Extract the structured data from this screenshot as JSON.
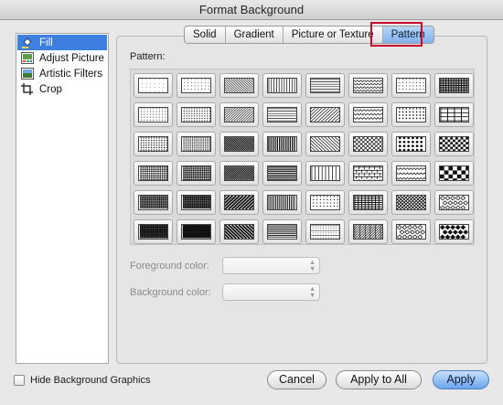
{
  "window": {
    "title": "Format Background"
  },
  "sidebar": {
    "items": [
      {
        "label": "Fill",
        "icon": "paint-bucket-icon",
        "selected": true
      },
      {
        "label": "Adjust Picture",
        "icon": "adjust-picture-icon",
        "selected": false
      },
      {
        "label": "Artistic Filters",
        "icon": "artistic-filters-icon",
        "selected": false
      },
      {
        "label": "Crop",
        "icon": "crop-icon",
        "selected": false
      }
    ]
  },
  "tabs": [
    {
      "label": "Solid",
      "selected": false
    },
    {
      "label": "Gradient",
      "selected": false
    },
    {
      "label": "Picture or Texture",
      "selected": false
    },
    {
      "label": "Pattern",
      "selected": true
    }
  ],
  "pattern_section": {
    "label": "Pattern:"
  },
  "patterns": [
    "dots-5",
    "dots-10",
    "diag-dn-light",
    "vert-light",
    "dash-horiz",
    "zigzag",
    "confetti",
    "grid-small",
    "dots-20",
    "dots-25",
    "diag-up-light",
    "horiz-light",
    "dash-diag-up",
    "wave",
    "confetti-large",
    "grid-large",
    "dots-30",
    "dots-40",
    "diag-dn-dark",
    "vert-dark",
    "dash-diag-dn",
    "diag-brick",
    "sphere",
    "checker-small",
    "dots-50",
    "dots-60",
    "diag-up-dark",
    "horiz-dark",
    "dash-vert",
    "brick",
    "shingle",
    "checker-large",
    "dots-70",
    "dots-75",
    "diag-up-wide",
    "vert-narrow",
    "divot",
    "plaid",
    "trellis",
    "diamond-outline",
    "dots-80",
    "dots-90",
    "diag-dn-wide",
    "horiz-narrow",
    "dotted-grid",
    "weave",
    "dotted-diamond",
    "diamond-solid"
  ],
  "foreground": {
    "label": "Foreground color:"
  },
  "background": {
    "label": "Background color:"
  },
  "hide_graphics": {
    "label": "Hide Background Graphics",
    "checked": false
  },
  "buttons": {
    "cancel": "Cancel",
    "apply_all": "Apply to All",
    "apply": "Apply"
  },
  "colors": {
    "accent": "#3d80df",
    "highlight": "#c8102e"
  }
}
